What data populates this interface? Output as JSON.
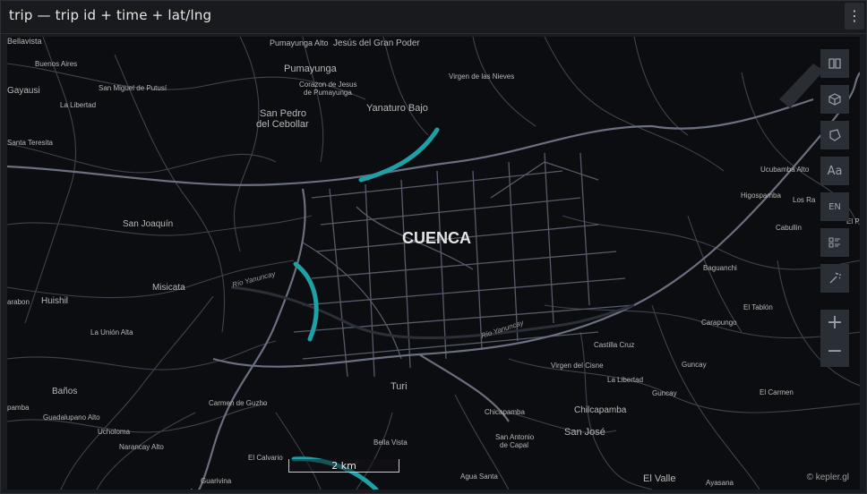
{
  "header": {
    "title": "trip — trip id + time + lat/lng",
    "menu_icon": "vertical-ellipsis-icon"
  },
  "map": {
    "city_label": "CUENCA",
    "place_labels": [
      "Bellavista",
      "Pumayunga Alto",
      "Jesús del Gran Poder",
      "Buenos Aires",
      "Pumayunga",
      "Gayausi",
      "Virgen de las Nieves",
      "San Miguel de Putusí",
      "Corazon de Jesus",
      "de Pumayunga",
      "La Libertad",
      "Yanaturo Bajo",
      "San Pedro",
      "del Cebollar",
      "Santa Teresita",
      "Ucubamba Alto",
      "Higospamba",
      "Los Ra",
      "San Joaquín",
      "Cabullin",
      "El Pl",
      "Baguanchi",
      "Huishil",
      "Misicata",
      "arabon",
      "El Tablón",
      "Carapungo",
      "La Unión Alta",
      "Castilla Cruz",
      "Virgen del Cisne",
      "Guncay",
      "Baños",
      "La Libertad",
      "Guncay",
      "El Carmen",
      "Turi",
      "Carmen de Guzho",
      "pamba",
      "Chicapamba",
      "Chilcapamba",
      "Guadalupano Alto",
      "Ucholoma",
      "San Antonio",
      "de Capal",
      "San José",
      "Narancay Alto",
      "Bella Vista",
      "El Calvario",
      "Agua Santa",
      "Guarivina",
      "El Valle",
      "Ayasana"
    ],
    "river_labels": [
      "Río Yanuncay",
      "Río Yanuncay"
    ],
    "scale_label": "2 km",
    "attribution": "© kepler.gl",
    "colors": {
      "background": "#0c0d10",
      "roads": "#4a4f5c",
      "trip": "#1ea0a6",
      "labels": "#b8b8b8"
    }
  },
  "controls": {
    "items": [
      "book-icon",
      "cube-icon",
      "polygon-draw-icon",
      "Aa",
      "EN",
      "legend-icon",
      "magic-wand-icon"
    ],
    "zoom_in": "+",
    "zoom_out": "−"
  }
}
